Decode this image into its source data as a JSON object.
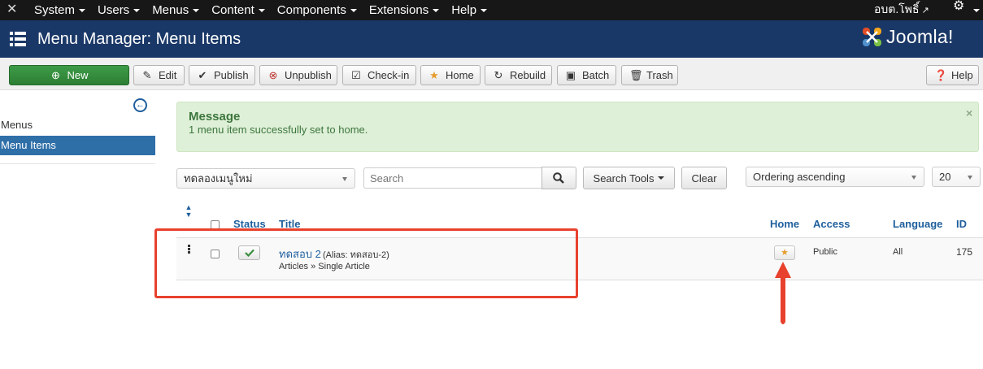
{
  "topbar": {
    "menu": [
      "System",
      "Users",
      "Menus",
      "Content",
      "Components",
      "Extensions",
      "Help"
    ],
    "user_name": "อบต.โพธิ์"
  },
  "header": {
    "title": "Menu Manager: Menu Items",
    "brand": "Joomla!"
  },
  "toolbar": {
    "new": "New",
    "edit": "Edit",
    "publish": "Publish",
    "unpublish": "Unpublish",
    "checkin": "Check-in",
    "home": "Home",
    "rebuild": "Rebuild",
    "batch": "Batch",
    "trash": "Trash",
    "help": "Help"
  },
  "sidebar": {
    "items": [
      {
        "label": "Menus",
        "active": false
      },
      {
        "label": "Menu Items",
        "active": true
      }
    ]
  },
  "message": {
    "heading": "Message",
    "text": "1 menu item successfully set to home.",
    "close": "×"
  },
  "filters": {
    "menu_select": "ทดลองเมนูใหม่",
    "search_placeholder": "Search",
    "search_tools": "Search Tools",
    "clear": "Clear",
    "ordering": "Ordering ascending",
    "limit": "20"
  },
  "table": {
    "headers": {
      "status": "Status",
      "title": "Title",
      "home": "Home",
      "access": "Access",
      "language": "Language",
      "id": "ID"
    },
    "rows": [
      {
        "title": "ทดสอบ 2",
        "alias": "(Alias: ทดสอบ-2)",
        "type": "Articles » Single Article",
        "published": true,
        "home": true,
        "access": "Public",
        "language": "All",
        "id": "175"
      }
    ]
  },
  "colors": {
    "navbar": "#171717",
    "header": "#1a3867",
    "new_button": "#2f8a36",
    "link": "#1f5f9d",
    "sidebar_active": "#2f6fa8",
    "alert_bg": "#dff0d8",
    "annotation": "#e8412d"
  }
}
